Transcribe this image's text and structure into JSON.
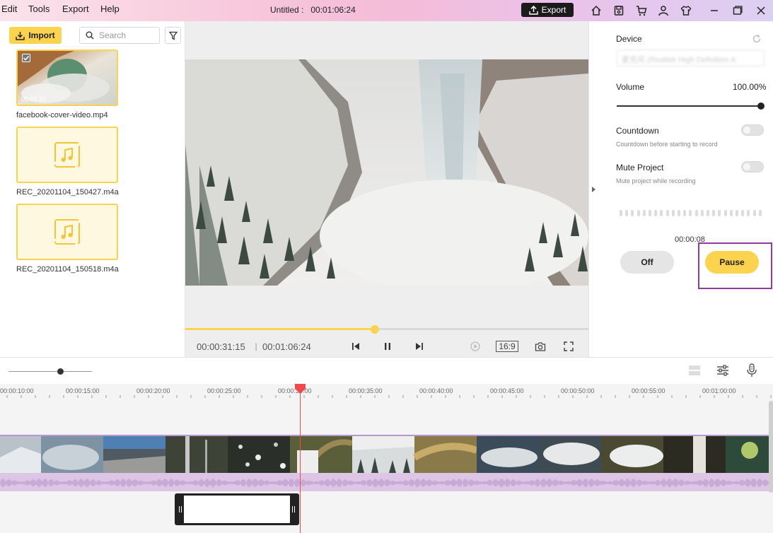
{
  "menu": [
    "Edit",
    "Tools",
    "Export",
    "Help"
  ],
  "document": {
    "title": "Untitled :",
    "duration": "00:01:06:24"
  },
  "title_bar": {
    "export_label": "Export"
  },
  "media_panel": {
    "import_label": "Import",
    "search_placeholder": "Search",
    "items": [
      {
        "name": "facebook-cover-video.mp4",
        "duration": "00:01:30",
        "type": "video",
        "checked": true
      },
      {
        "name": "REC_20201104_150427.m4a",
        "type": "audio"
      },
      {
        "name": "REC_20201104_150518.m4a",
        "type": "audio"
      }
    ]
  },
  "player": {
    "current_time": "00:00:31:15",
    "total_time": "00:01:06:24",
    "aspect_ratio": "16:9",
    "progress": 0.47
  },
  "record_panel": {
    "device_label": "Device",
    "device_value": "麦克风 (Realtek High Definition A",
    "volume_label": "Volume",
    "volume_value": "100.00%",
    "volume_level": 1.0,
    "countdown_label": "Countdown",
    "countdown_desc": "Countdown before starting to record",
    "mute_label": "Mute Project",
    "mute_desc": "Mute project while recording",
    "elapsed": "00:00:08",
    "off_label": "Off",
    "pause_label": "Pause"
  },
  "timeline": {
    "zoom_level": 0.62,
    "ruler": [
      "00:00:10:00",
      "00:00:15:00",
      "00:00:20:00",
      "00:00:25:00",
      "00:00:30:00",
      "00:00:35:00",
      "00:00:40:00",
      "00:00:45:00",
      "00:00:50:00",
      "00:00:55:00",
      "00:01:00:00"
    ]
  },
  "colors": {
    "accent": "#fbd34e",
    "playhead": "#f04b4b",
    "highlight": "#8e3e9a",
    "audio_track": "#ddc5e5"
  }
}
